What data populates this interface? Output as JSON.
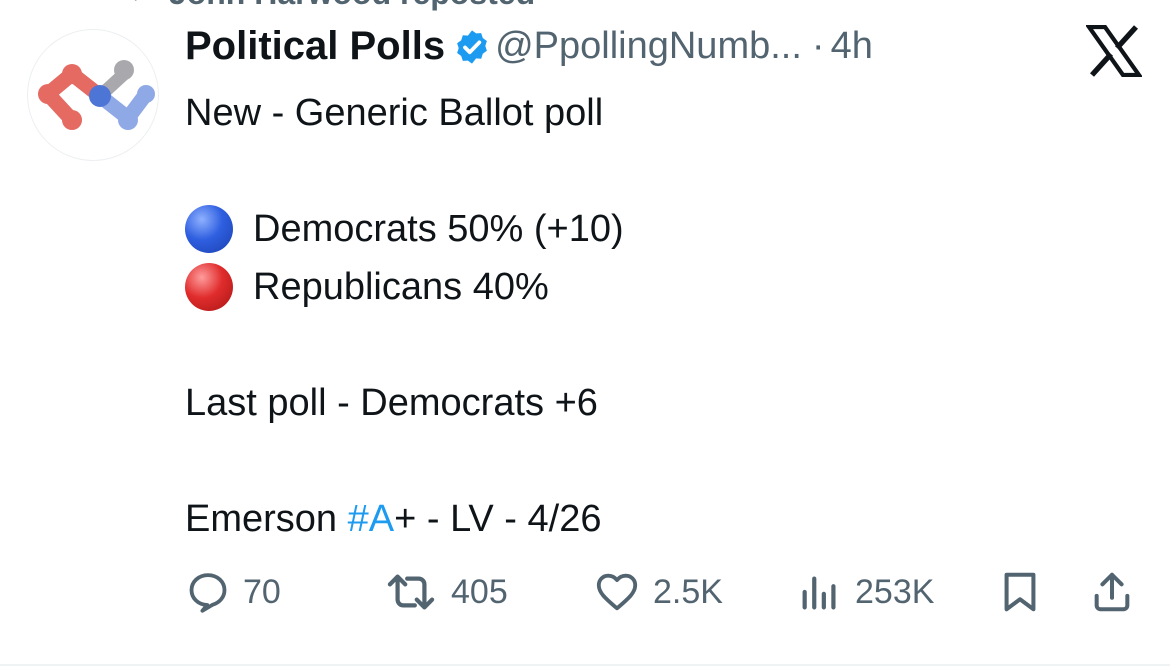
{
  "repost": {
    "text": "John Harwood reposted"
  },
  "tweet": {
    "author_name": "Political Polls",
    "handle": "@PpollingNumb...",
    "separator": "·",
    "time": "4h",
    "lines": {
      "title": "New - Generic Ballot poll",
      "dem": "Democrats 50% (+10)",
      "rep": "Republicans 40%",
      "last_poll": "Last poll - Democrats +6",
      "source_prefix": "Emerson ",
      "hashtag": "#A",
      "source_suffix": "+ - LV - 4/26"
    }
  },
  "actions": {
    "replies": "70",
    "reposts": "405",
    "likes": "2.5K",
    "views": "253K"
  },
  "colors": {
    "accent": "#1d9bf0",
    "muted": "#536471",
    "text": "#0f1419",
    "verified": "#1d9bf0"
  },
  "icons": [
    "repost-icon",
    "verified-badge-icon",
    "x-logo-icon",
    "reply-icon",
    "repost-icon",
    "like-icon",
    "views-icon",
    "bookmark-icon",
    "share-icon"
  ]
}
